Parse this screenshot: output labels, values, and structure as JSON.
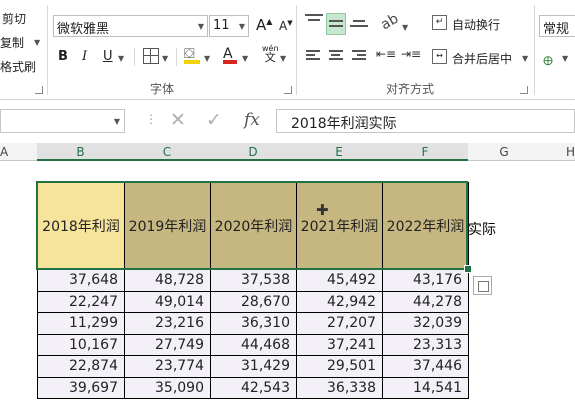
{
  "ribbon": {
    "clipboard": {
      "cut": "剪切",
      "copy": "复制",
      "painter": "格式刷"
    },
    "font": {
      "font_name": "微软雅黑",
      "font_size": "11",
      "grow": "A",
      "shrink": "A",
      "bold": "B",
      "italic": "I",
      "underline": "U",
      "font_color": "A",
      "phonetic": "wén",
      "group_label": "字体"
    },
    "alignment": {
      "wrap_text": "自动换行",
      "merge_center": "合并后居中",
      "group_label": "对齐方式"
    },
    "number": {
      "format": "常规"
    }
  },
  "formula_bar": {
    "cell_ref": "",
    "fx": "fx",
    "content": "2018年利润实际"
  },
  "columns": [
    "A",
    "B",
    "C",
    "D",
    "E",
    "F",
    "G",
    "H"
  ],
  "table": {
    "headers": [
      "2018年利润",
      "2019年利润",
      "2020年利润",
      "2021年利润",
      "2022年利润"
    ],
    "overflow_text": "实际",
    "rows": [
      [
        "37,648",
        "48,728",
        "37,538",
        "45,492",
        "43,176"
      ],
      [
        "22,247",
        "49,014",
        "28,670",
        "42,942",
        "44,278"
      ],
      [
        "11,299",
        "23,216",
        "36,310",
        "27,207",
        "32,039"
      ],
      [
        "10,167",
        "27,749",
        "44,468",
        "37,241",
        "23,313"
      ],
      [
        "22,874",
        "23,774",
        "31,429",
        "29,501",
        "37,446"
      ],
      [
        "39,697",
        "35,090",
        "42,543",
        "36,338",
        "14,541"
      ]
    ]
  },
  "colors": {
    "accent": "#217346",
    "header_fill": "#c6b67f",
    "active_fill": "#f6e49a"
  }
}
